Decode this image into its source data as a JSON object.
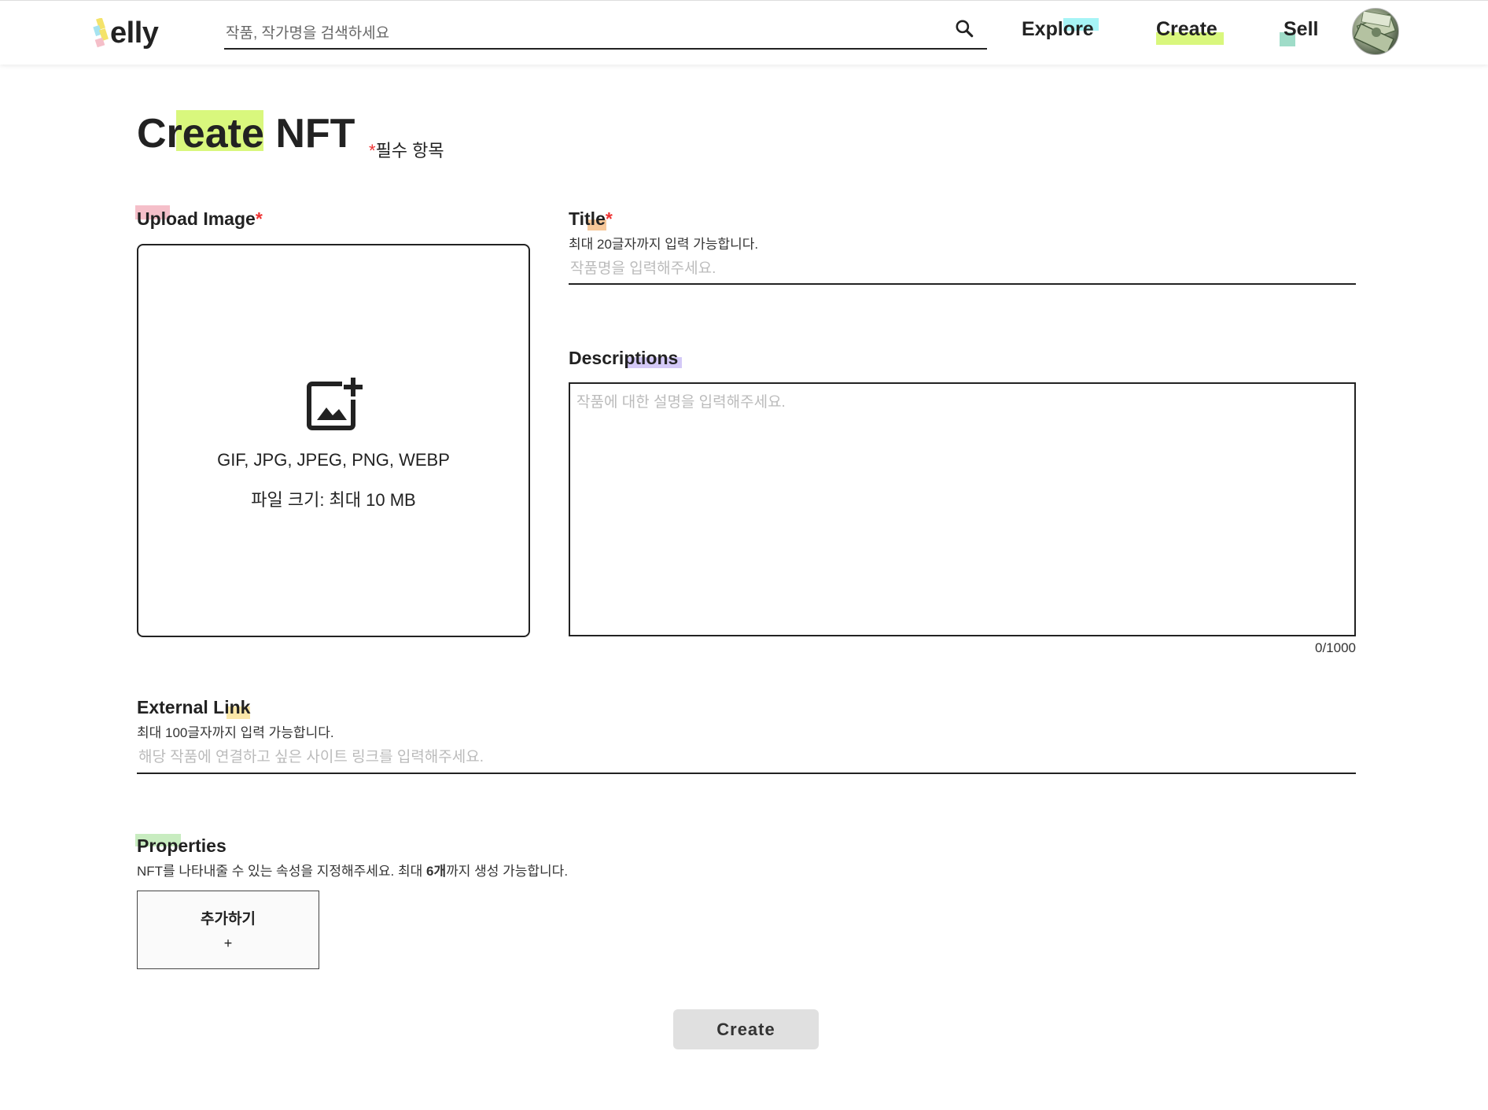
{
  "app": {
    "name": "elly",
    "logo_letter": "S"
  },
  "header": {
    "search_placeholder": "작품, 작가명을 검색하세요",
    "nav": {
      "explore": "Explore",
      "create": "Create",
      "sell": "Sell"
    }
  },
  "page": {
    "title": "Create NFT",
    "required_star": "*",
    "required_note": "필수 항목"
  },
  "upload": {
    "label": "Upload Image",
    "formats": "GIF, JPG, JPEG, PNG, WEBP",
    "size": "파일 크기: 최대 10 MB"
  },
  "title_field": {
    "label": "Title",
    "hint": "최대 20글자까지 입력 가능합니다.",
    "placeholder": "작품명을 입력해주세요.",
    "value": ""
  },
  "description_field": {
    "label": "Descriptions",
    "placeholder": "작품에 대한 설명을 입력해주세요.",
    "counter": "0/1000"
  },
  "external_link": {
    "label": "External Link",
    "hint": "최대 100글자까지 입력 가능합니다.",
    "placeholder": "해당 작품에 연결하고 싶은 사이트 링크를 입력해주세요."
  },
  "properties": {
    "label": "Properties",
    "hint_before": "NFT를 나타내줄 수 있는 속성을 지정해주세요. 최대 ",
    "hint_count": "6개",
    "hint_after": "까지 생성 가능합니다.",
    "add_label": "추가하기",
    "add_symbol": "+"
  },
  "actions": {
    "create": "Create"
  },
  "colors": {
    "accent_green": "#d9f77d",
    "accent_cyan": "#a6f4f6",
    "accent_teal": "#9fdcc8",
    "accent_pink": "#f5bfc9",
    "accent_orange": "#f7c89a",
    "accent_purple": "#d4c9f7",
    "accent_yellow": "#fbe7a8",
    "accent_lightgreen": "#c8ecc0",
    "required_red": "#e33333"
  }
}
